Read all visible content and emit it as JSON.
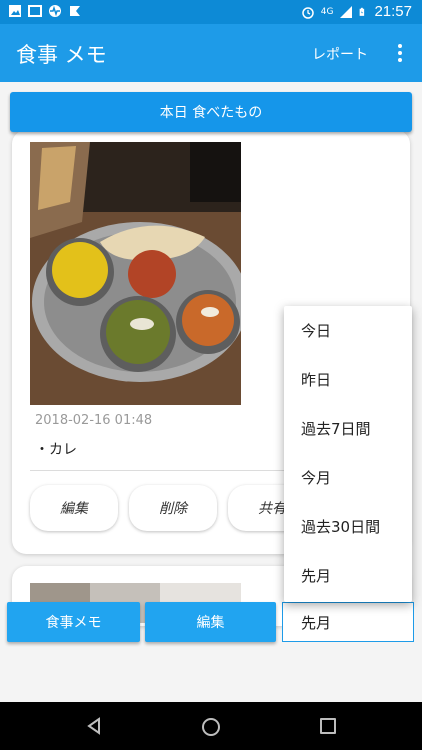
{
  "status_bar": {
    "time": "21:57",
    "network": "4G",
    "left_icons": [
      "image-icon",
      "frame-icon",
      "activity-icon",
      "notification-icon"
    ],
    "right_icons": [
      "alarm-icon",
      "signal-icon",
      "battery-icon"
    ]
  },
  "app_bar": {
    "title": "食事 メモ",
    "report_label": "レポート",
    "menu_icon": "overflow-menu-icon"
  },
  "today_button": {
    "label": "本日 食べたもの"
  },
  "entries": [
    {
      "timestamp": "2018-02-16 01:48",
      "items": "・カレ",
      "actions": {
        "edit": "編集",
        "delete": "削除",
        "share": "共有"
      }
    }
  ],
  "bottom_bar": {
    "memo_label": "食事メモ",
    "edit_label": "編集",
    "period_selected": "先月"
  },
  "period_dropdown": {
    "options": [
      "今日",
      "昨日",
      "過去7日間",
      "今月",
      "過去30日間",
      "先月"
    ]
  },
  "colors": {
    "primary": "#1e9be8",
    "primary_dark": "#0d8ad6",
    "button": "#21a4f0"
  }
}
